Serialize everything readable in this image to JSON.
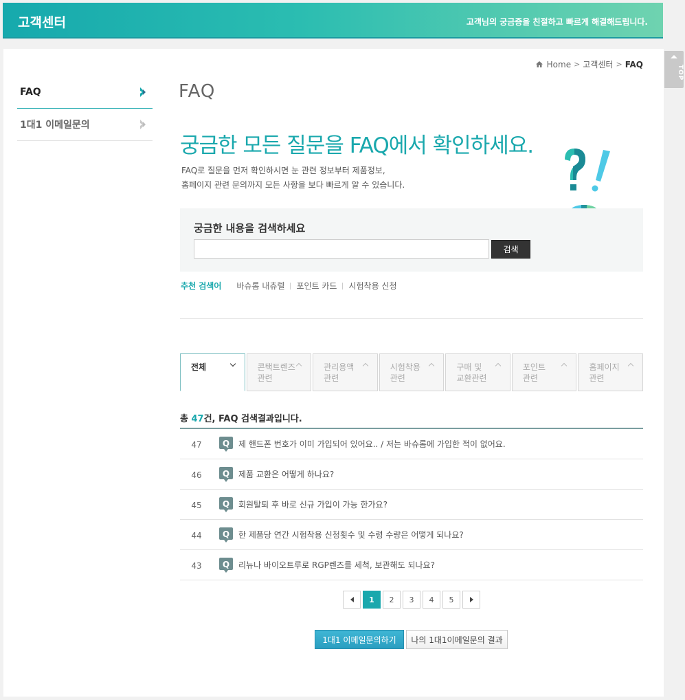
{
  "header": {
    "title": "고객센터",
    "tagline": "고객님의 궁금증을 친절하고 빠르게 해결해드립니다."
  },
  "top_button": {
    "label": "TOP"
  },
  "breadcrumb": {
    "home": "Home",
    "section": "고객센터",
    "current": "FAQ"
  },
  "sidebar": {
    "items": [
      {
        "label": "FAQ",
        "active": true
      },
      {
        "label": "1대1 이메일문의",
        "active": false
      }
    ]
  },
  "main": {
    "page_title": "FAQ",
    "headline": "궁금한 모든 질문을 FAQ에서 확인하세요.",
    "desc_line1": "FAQ로 질문을 먼저 확인하시면 눈 관련 정보부터 제품정보,",
    "desc_line2": "홈페이지 관련 문의까지 모든 사항을 보다 빠르게 알 수 있습니다."
  },
  "search": {
    "label": "궁금한 내용을 검색하세요",
    "value": "",
    "placeholder": "",
    "button": "검색"
  },
  "recommended": {
    "label": "추천 검색어",
    "keywords": [
      "바슈롬 내츄렐",
      "포인트 카드",
      "시험착용 신청"
    ]
  },
  "tabs": [
    {
      "line1": "전체",
      "line2": "",
      "active": true
    },
    {
      "line1": "콘택트렌즈",
      "line2": "관련",
      "active": false
    },
    {
      "line1": "관리용액",
      "line2": "관련",
      "active": false
    },
    {
      "line1": "시험착용",
      "line2": "관련",
      "active": false
    },
    {
      "line1": "구매 및",
      "line2": "교환관련",
      "active": false
    },
    {
      "line1": "포인트",
      "line2": "관련",
      "active": false
    },
    {
      "line1": "홈페이지",
      "line2": "관련",
      "active": false
    }
  ],
  "results": {
    "prefix": "총 ",
    "count": "47",
    "suffix": "건, FAQ 검색결과입니다."
  },
  "faq_icon": "Q",
  "faqs": [
    {
      "no": "47",
      "question": "제 핸드폰 번호가 이미 가입되어 있어요.. / 저는 바슈롬에 가입한 적이 없어요."
    },
    {
      "no": "46",
      "question": "제품 교환은 어떻게 하나요?"
    },
    {
      "no": "45",
      "question": "회원탈퇴 후 바로 신규 가입이 가능 한가요?"
    },
    {
      "no": "44",
      "question": "한 제품당 연간 시험착용 신청횟수 및 수령 수량은 어떻게 되나요?"
    },
    {
      "no": "43",
      "question": "리뉴나 바이오트루로 RGP렌즈를 세척, 보관해도 되나요?"
    }
  ],
  "pagination": {
    "pages": [
      "1",
      "2",
      "3",
      "4",
      "5"
    ],
    "current": "1"
  },
  "buttons": {
    "email_inquiry": "1대1 이메일문의하기",
    "my_results": "나의 1대1이메일문의 결과"
  },
  "colors": {
    "accent": "#1aa8ad",
    "header_start": "#16a9ad",
    "header_end": "#6fd3b0",
    "dark_button": "#333333"
  }
}
